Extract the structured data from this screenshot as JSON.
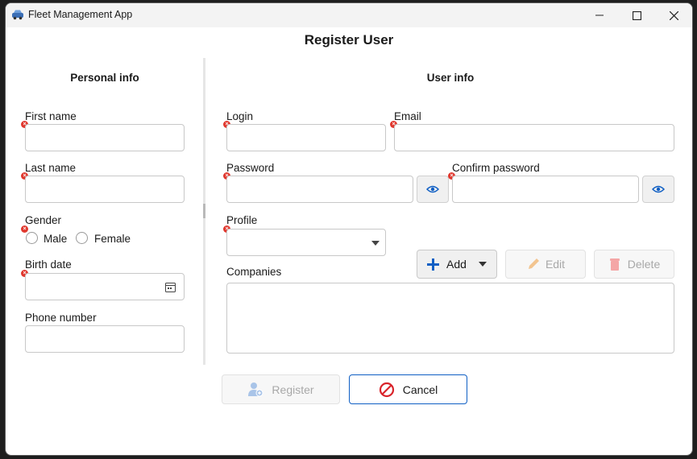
{
  "window": {
    "title": "Fleet Management App"
  },
  "page": {
    "title": "Register User"
  },
  "personal": {
    "title": "Personal info",
    "first_name_label": "First name",
    "last_name_label": "Last name",
    "gender_label": "Gender",
    "gender_options": [
      "Male",
      "Female"
    ],
    "birth_date_label": "Birth date",
    "phone_label": "Phone number"
  },
  "user": {
    "title": "User info",
    "login_label": "Login",
    "email_label": "Email",
    "password_label": "Password",
    "confirm_password_label": "Confirm password",
    "profile_label": "Profile",
    "companies_label": "Companies",
    "add_label": "Add",
    "edit_label": "Edit",
    "delete_label": "Delete"
  },
  "actions": {
    "register_label": "Register",
    "cancel_label": "Cancel"
  },
  "colors": {
    "accent": "#0f5fc4",
    "error": "#e0382e",
    "delete": "#f4a6a6",
    "edit": "#f2c48f",
    "cancel_icon": "#d9242b"
  },
  "icons": [
    "car-icon",
    "minimize-icon",
    "maximize-icon",
    "close-icon",
    "error-icon",
    "eye-icon",
    "calendar-icon",
    "dropdown-arrow-icon",
    "plus-icon",
    "pencil-icon",
    "trash-icon",
    "add-user-icon",
    "cancel-icon"
  ]
}
